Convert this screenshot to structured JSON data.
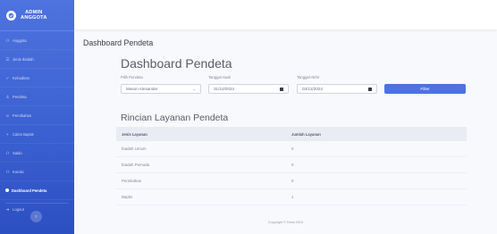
{
  "sidebar": {
    "brand_line1": "ADMIN",
    "brand_line2": "ANGGOTA",
    "items": [
      {
        "label": "Anggota",
        "icon": "users-icon"
      },
      {
        "label": "Jenis Ibadah",
        "icon": "list-icon"
      },
      {
        "label": "Kehadiran",
        "icon": "check-icon"
      },
      {
        "label": "Pendeta",
        "icon": "user-icon"
      },
      {
        "label": "Pernikahan",
        "icon": "rings-icon"
      },
      {
        "label": "Calon Baptis",
        "icon": "user-plus-icon"
      },
      {
        "label": "Saldo",
        "icon": "wallet-icon"
      },
      {
        "label": "Komisi",
        "icon": "group-icon"
      },
      {
        "label": "Dashboard Pendeta",
        "icon": "dashboard-icon"
      },
      {
        "label": "Logout",
        "icon": "logout-icon"
      }
    ],
    "active_index": 8
  },
  "page": {
    "heading": "Dashboard Pendeta",
    "card_title": "Dashboard Pendeta"
  },
  "filters": {
    "pendeta_label": "Pilih Pendeta",
    "pendeta_value": "Mason Alexander",
    "start_label": "Tanggal Awal",
    "start_value": "31/10/2024",
    "end_label": "Tanggal Akhir",
    "end_value": "03/12/2024",
    "filter_button": "Filter"
  },
  "table": {
    "title": "Rincian Layanan Pendeta",
    "headers": [
      "Jenis Layanan",
      "Jumlah Layanan"
    ],
    "rows": [
      [
        "Ibadah Umum",
        "0"
      ],
      [
        "Ibadah Pemuda",
        "0"
      ],
      [
        "Pernikahan",
        "0"
      ],
      [
        "Baptis",
        "1"
      ]
    ]
  },
  "footer": "Copyright © Desa 2024",
  "colors": {
    "sidebar": "#4e73df",
    "accent": "#4e73df",
    "background": "#f8f9fc"
  }
}
